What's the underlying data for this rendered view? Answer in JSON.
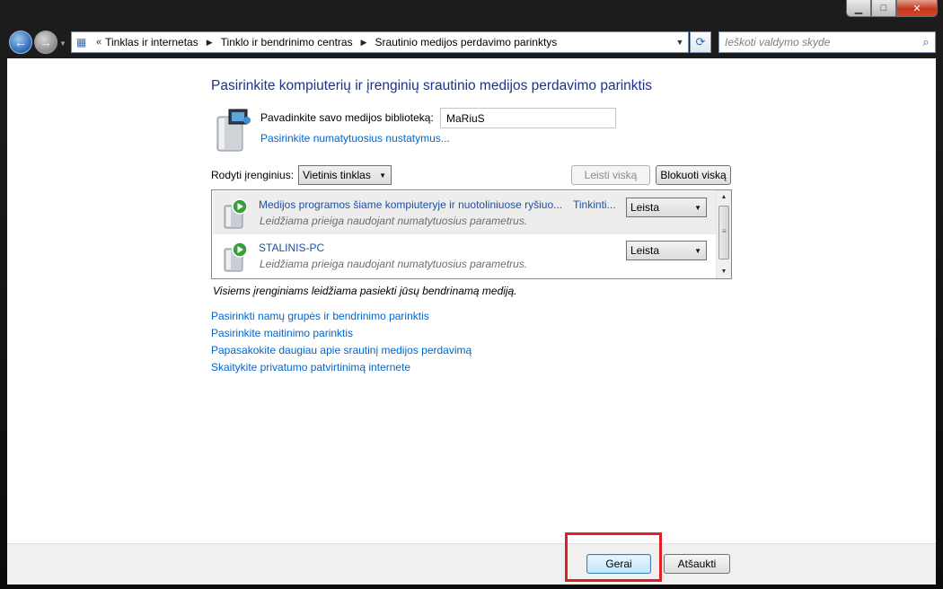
{
  "window": {
    "caption_buttons": {
      "minimize": "▁",
      "maximize": "□",
      "close": "✕"
    }
  },
  "nav": {
    "back_icon": "arrow-left-icon",
    "forward_icon": "arrow-right-icon",
    "breadcrumb_prefix": "«",
    "breadcrumbs": [
      "Tinklas ir internetas",
      "Tinklo ir bendrinimo centras",
      "Srautinio medijos perdavimo parinktys"
    ],
    "search_placeholder": "Ieškoti valdymo skyde"
  },
  "main": {
    "title": "Pasirinkite kompiuterių ir įrenginių srautinio medijos perdavimo parinktis",
    "library_label": "Pavadinkite savo medijos biblioteką:",
    "library_value": "MaRiuS",
    "defaults_link": "Pasirinkite numatytuosius nustatymus...",
    "show_devices_label": "Rodyti įrenginius:",
    "show_devices_value": "Vietinis tinklas",
    "allow_all_label": "Leisti viską",
    "block_all_label": "Blokuoti viską",
    "devices": [
      {
        "name": "Medijos programos šiame kompiuteryje ir nuotoliniuose ryšiuo...",
        "extra": "Tinkinti...",
        "description": "Leidžiama prieiga naudojant numatytuosius parametrus.",
        "permission": "Leista"
      },
      {
        "name": "STALINIS-PC",
        "extra": "",
        "description": "Leidžiama prieiga naudojant numatytuosius parametrus.",
        "permission": "Leista"
      }
    ],
    "note": "Visiems įrenginiams leidžiama pasiekti jūsų bendrinamą mediją.",
    "links": [
      "Pasirinkti namų grupės ir bendrinimo parinktis",
      "Pasirinkite maitinimo parinktis",
      "Papasakokite daugiau apie srautinį medijos perdavimą",
      "Skaitykite privatumo patvirtinimą internete"
    ]
  },
  "footer": {
    "ok_label": "Gerai",
    "cancel_label": "Atšaukti"
  },
  "colors": {
    "title": "#1e3287",
    "link": "#0066cc",
    "highlight": "#e31e24"
  }
}
